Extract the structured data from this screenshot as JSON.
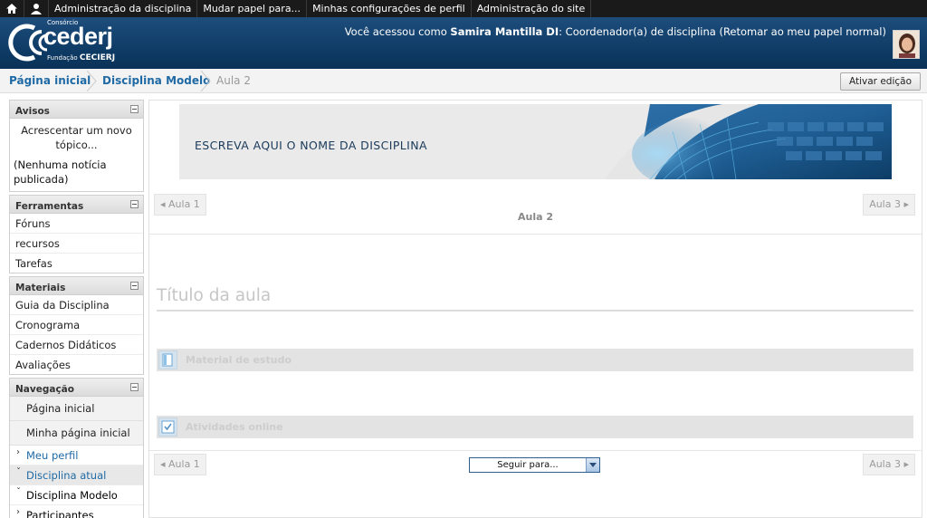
{
  "topbar": {
    "items": [
      "Administração da disciplina",
      "Mudar papel para...",
      "Minhas configurações de perfil",
      "Administração do site"
    ]
  },
  "logo": {
    "small": "Consórcio",
    "main": "cederj",
    "foot_small": "Fundação",
    "foot_bold": "CECIERJ"
  },
  "login": {
    "prefix": "Você acessou como ",
    "user": "Samira Mantilla DI",
    "suffix": ": Coordenador(a) de disciplina (Retomar ao meu papel normal)"
  },
  "breadcrumb": {
    "home": "Página inicial",
    "course": "Disciplina Modelo",
    "current": "Aula 2"
  },
  "edit_button": "Ativar edição",
  "blocks": {
    "avisos": {
      "title": "Avisos",
      "add": "Acrescentar um novo tópico...",
      "empty": "(Nenhuma notícia publicada)"
    },
    "ferramentas": {
      "title": "Ferramentas",
      "items": [
        "Fóruns",
        "recursos",
        "Tarefas"
      ]
    },
    "materiais": {
      "title": "Materiais",
      "items": [
        "Guia da Disciplina",
        "Cronograma",
        "Cadernos Didáticos",
        "Avaliações"
      ]
    },
    "navegacao": {
      "title": "Navegação",
      "items": [
        "Página inicial",
        "Minha página inicial"
      ],
      "sub": [
        "Meu perfil",
        "Disciplina atual",
        "Disciplina Modelo",
        "Participantes"
      ]
    }
  },
  "main": {
    "banner_text": "ESCREVA AQUI O NOME DA DISCIPLINA",
    "prev": "◂ Aula 1",
    "next": "Aula 3 ▸",
    "section_title": "Aula 2",
    "aula_title": "Título da aula",
    "sections": [
      "Material de estudo",
      "Atividades online"
    ],
    "jump": "Seguir para..."
  },
  "colors": {
    "header": "#0d3a63",
    "link": "#1f6aa5",
    "topbar": "#1a1a1a"
  }
}
